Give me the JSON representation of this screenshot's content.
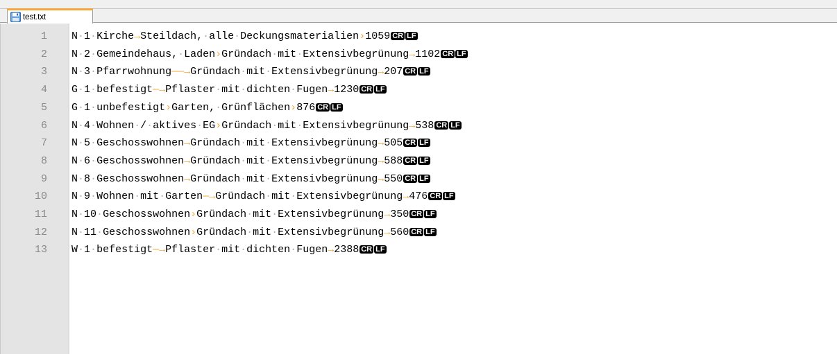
{
  "tab": {
    "label": "test.txt",
    "icon": "save-disk-icon"
  },
  "colors": {
    "tab_accent": "#f4a63a",
    "arrow": "#f4a63a",
    "space_dot": "#b0b0b0",
    "gutter": "#e4e4e4"
  },
  "symbols": {
    "space": "·",
    "tab_short": "›",
    "tab_long": "—›",
    "cr": "CR",
    "lf": "LF"
  },
  "lines": [
    {
      "num": "1",
      "tokens": [
        "N",
        "1",
        "Kirche",
        "→",
        "Steildach,",
        "alle",
        "Deckungsmaterialien",
        "›",
        "1059"
      ]
    },
    {
      "num": "2",
      "tokens": [
        "N",
        "2",
        "Gemeindehaus,",
        "Laden",
        "›",
        "Gründach",
        "mit",
        "Extensivbegrünung",
        "→",
        "1102"
      ]
    },
    {
      "num": "3",
      "tokens": [
        "N",
        "3",
        "Pfarrwohnung",
        "——→",
        "Gründach",
        "mit",
        "Extensivbegrünung",
        "→",
        "207"
      ]
    },
    {
      "num": "4",
      "tokens": [
        "G",
        "1",
        "befestigt",
        "—→",
        "Pflaster",
        "mit",
        "dichten",
        "Fugen",
        "→",
        "1230"
      ]
    },
    {
      "num": "5",
      "tokens": [
        "G",
        "1",
        "unbefestigt",
        "›",
        "Garten,",
        "Grünflächen",
        "›",
        "876"
      ]
    },
    {
      "num": "6",
      "tokens": [
        "N",
        "4",
        "Wohnen",
        "/",
        "aktives",
        "EG",
        "›",
        "Gründach",
        "mit",
        "Extensivbegrünung",
        "→",
        "538"
      ]
    },
    {
      "num": "7",
      "tokens": [
        "N",
        "5",
        "Geschosswohnen",
        "→",
        "Gründach",
        "mit",
        "Extensivbegrünung",
        "→",
        "505"
      ]
    },
    {
      "num": "8",
      "tokens": [
        "N",
        "6",
        "Geschosswohnen",
        "→",
        "Gründach",
        "mit",
        "Extensivbegrünung",
        "→",
        "588"
      ]
    },
    {
      "num": "9",
      "tokens": [
        "N",
        "8",
        "Geschosswohnen",
        "→",
        "Gründach",
        "mit",
        "Extensivbegrünung",
        "→",
        "550"
      ]
    },
    {
      "num": "10",
      "tokens": [
        "N",
        "9",
        "Wohnen",
        "mit",
        "Garten",
        "—→",
        "Gründach",
        "mit",
        "Extensivbegrünung",
        "→",
        "476"
      ]
    },
    {
      "num": "11",
      "tokens": [
        "N",
        "10",
        "Geschosswohnen",
        "›",
        "Gründach",
        "mit",
        "Extensivbegrünung",
        "→",
        "350"
      ]
    },
    {
      "num": "12",
      "tokens": [
        "N",
        "11",
        "Geschosswohnen",
        "›",
        "Gründach",
        "mit",
        "Extensivbegrünung",
        "→",
        "560"
      ]
    },
    {
      "num": "13",
      "tokens": [
        "W",
        "1",
        "befestigt",
        "—→",
        "Pflaster",
        "mit",
        "dichten",
        "Fugen",
        "→",
        "2388"
      ]
    }
  ]
}
